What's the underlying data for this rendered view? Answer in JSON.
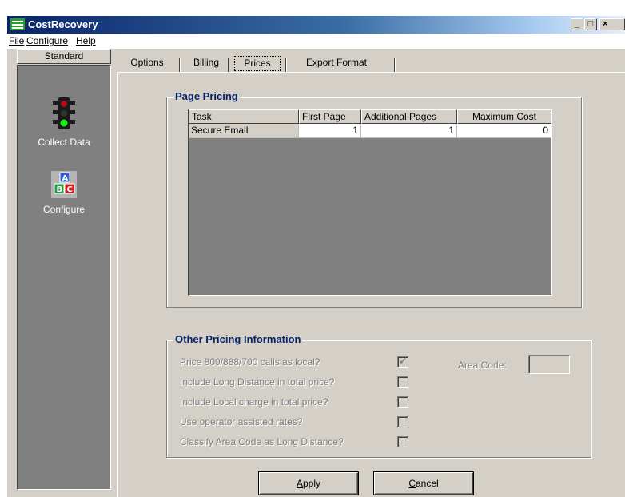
{
  "window": {
    "title": "CostRecovery",
    "controls": {
      "minimize": "_",
      "maximize": "□",
      "close": "×"
    }
  },
  "menu": [
    {
      "label": "File",
      "accel": "F"
    },
    {
      "label": "Configure",
      "accel": "C"
    },
    {
      "label": "Help",
      "accel": "H"
    }
  ],
  "sidebar": {
    "header": "Standard",
    "items": [
      {
        "label": "Collect Data",
        "icon": "traffic-light-icon"
      },
      {
        "label": "Configure",
        "icon": "abc-blocks-icon"
      }
    ]
  },
  "tabs": [
    {
      "label": "Options"
    },
    {
      "label": "Billing"
    },
    {
      "label": "Prices"
    },
    {
      "label": "Export Format"
    }
  ],
  "active_tab": "Prices",
  "page_pricing": {
    "title": "Page Pricing",
    "columns": [
      "Task",
      "First Page",
      "Additional Pages",
      "Maximum Cost"
    ],
    "rows": [
      {
        "task": "Secure Email",
        "first_page": "1",
        "additional_pages": "1",
        "maximum_cost": "0"
      }
    ]
  },
  "other_pricing": {
    "title": "Other Pricing Information",
    "options": [
      {
        "label": "Price 800/888/700  calls as local?",
        "checked": true
      },
      {
        "label": "Include Long Distance in total price?",
        "checked": false
      },
      {
        "label": "Include Local charge in total price?",
        "checked": false
      },
      {
        "label": "Use operator assisted rates?",
        "checked": false
      },
      {
        "label": "Classify Area Code as Long Distance?",
        "checked": false
      }
    ],
    "area_code_label": "Area Code:",
    "area_code_value": ""
  },
  "buttons": {
    "apply": {
      "accel": "A",
      "rest": "pply"
    },
    "cancel": {
      "accel": "C",
      "rest": "ancel"
    }
  },
  "colors": {
    "face": "#d4d0c8",
    "sidebar": "#808080",
    "group_title": "#0a246a",
    "title_gradient_start": "#0a246a"
  }
}
